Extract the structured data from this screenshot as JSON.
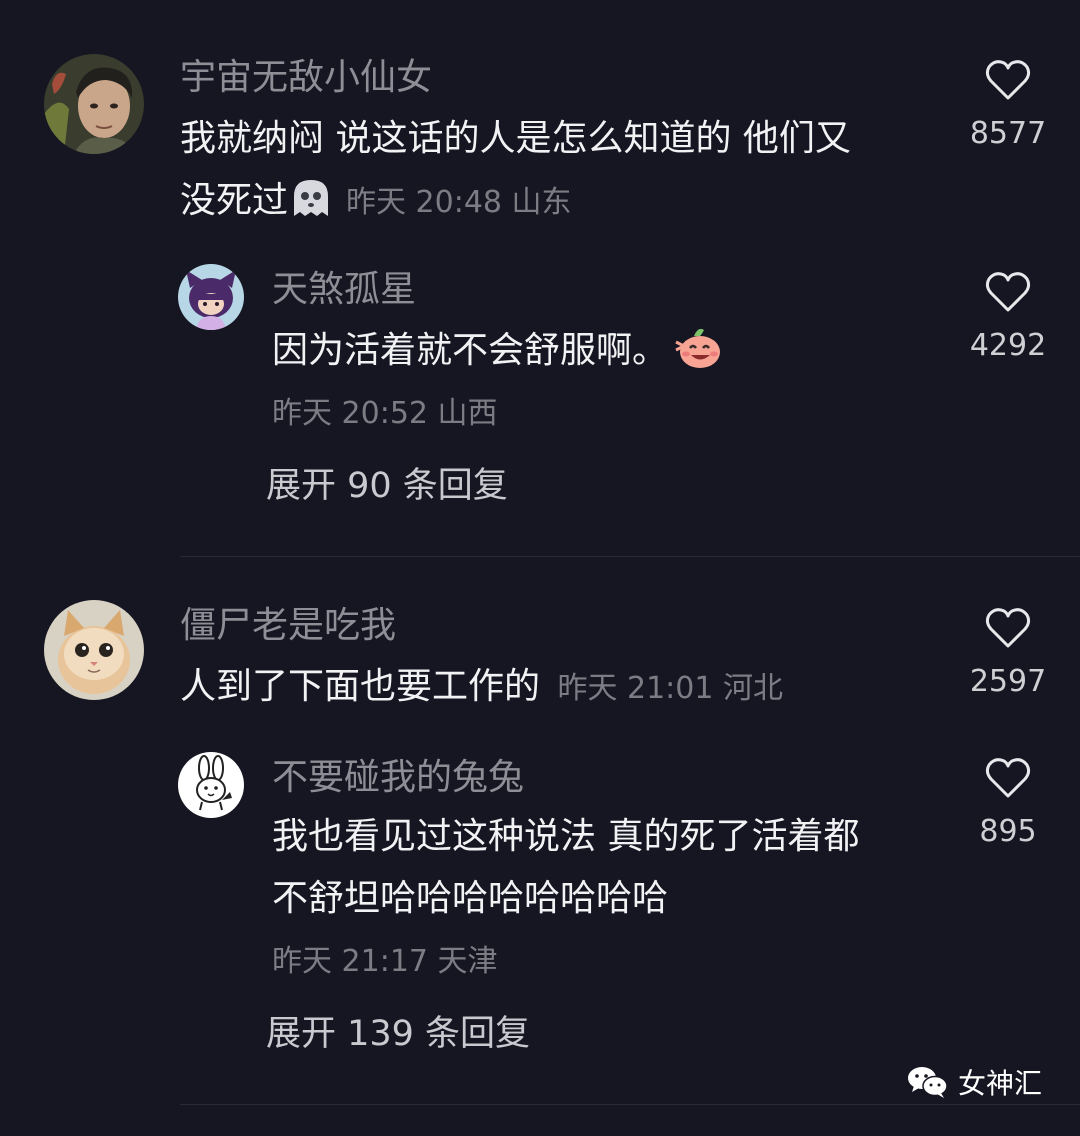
{
  "colors": {
    "background": "#161622",
    "username": "#8e8e96",
    "text": "#f2f2f4",
    "meta": "#7c7c85",
    "divider": "#2a2a36"
  },
  "comment1": {
    "username": "宇宙无敌小仙女",
    "text_line1": "我就纳闷 说这话的人是怎么知道的 他们又",
    "text_line2": "没死过",
    "emoji": "ghost-emoji",
    "meta": "昨天 20:48 山东",
    "likes": "8577"
  },
  "reply1": {
    "username": "天煞孤星",
    "text": "因为活着就不会舒服啊。",
    "emoji": "laughing-emoji",
    "meta": "昨天 20:52 山西",
    "likes": "4292"
  },
  "expand1": "展开 90 条回复",
  "comment2": {
    "username": "僵尸老是吃我",
    "text": "人到了下面也要工作的",
    "meta": "昨天 21:01 河北",
    "likes": "2597"
  },
  "reply2": {
    "username": "不要碰我的兔兔",
    "text_line1": "我也看见过这种说法 真的死了活着都",
    "text_line2": "不舒坦哈哈哈哈哈哈哈哈",
    "meta": "昨天 21:17 天津",
    "likes": "895"
  },
  "expand2": "展开 139 条回复",
  "watermark": "女神汇"
}
